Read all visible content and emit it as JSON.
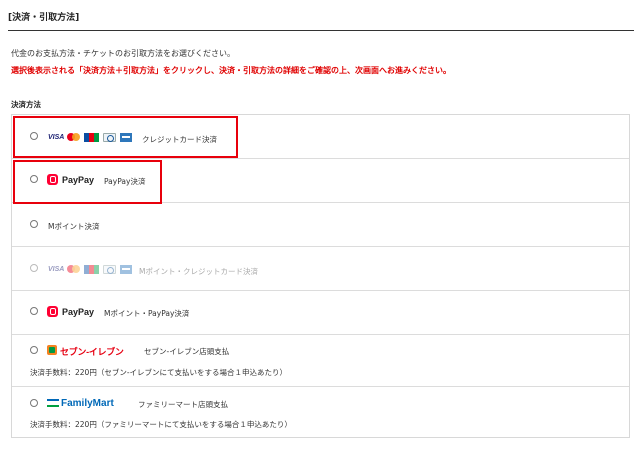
{
  "section_title": "[決済・引取方法]",
  "intro_line": "代金のお支払方法・チケットのお引取方法をお選びください。",
  "intro_warning": "選択後表示される「決済方法＋引取方法」をクリックし、決済・引取方法の詳細をご確認の上、次画面へお進みください。",
  "method_heading": "決済方法",
  "colors": {
    "highlight": "#e8000c",
    "warning": "#e00000",
    "paypay": "#ff0033",
    "familymart_blue": "#0068b7",
    "seven_red": "#e60012"
  },
  "options": [
    {
      "label": "クレジットカード決済",
      "logos": [
        "VISA",
        "mastercard-icon",
        "jcb-icon",
        "diners-icon",
        "amex-icon"
      ],
      "enabled": true,
      "highlighted": true
    },
    {
      "label": "PayPay決済",
      "logo_text": "PayPay",
      "enabled": true,
      "highlighted": true
    },
    {
      "label": "Mポイント決済",
      "enabled": true,
      "highlighted": false
    },
    {
      "label": "Mポイント・クレジットカード決済",
      "logos": [
        "VISA",
        "mastercard-icon",
        "jcb-icon",
        "diners-icon",
        "amex-icon"
      ],
      "enabled": false,
      "highlighted": false
    },
    {
      "label": "Mポイント・PayPay決済",
      "logo_text": "PayPay",
      "enabled": true,
      "highlighted": false
    },
    {
      "label": "セブン-イレブン店頭支払",
      "logo_text": "セブン-イレブン",
      "fee": "決済手数料：220円（セブン-イレブンにて支払いをする場合１申込あたり）",
      "enabled": true,
      "highlighted": false
    },
    {
      "label": "ファミリーマート店頭支払",
      "logo_text": "FamilyMart",
      "fee": "決済手数料：220円（ファミリーマートにて支払いをする場合１申込あたり）",
      "enabled": true,
      "highlighted": false
    }
  ],
  "logo_visa_text": "VISA"
}
